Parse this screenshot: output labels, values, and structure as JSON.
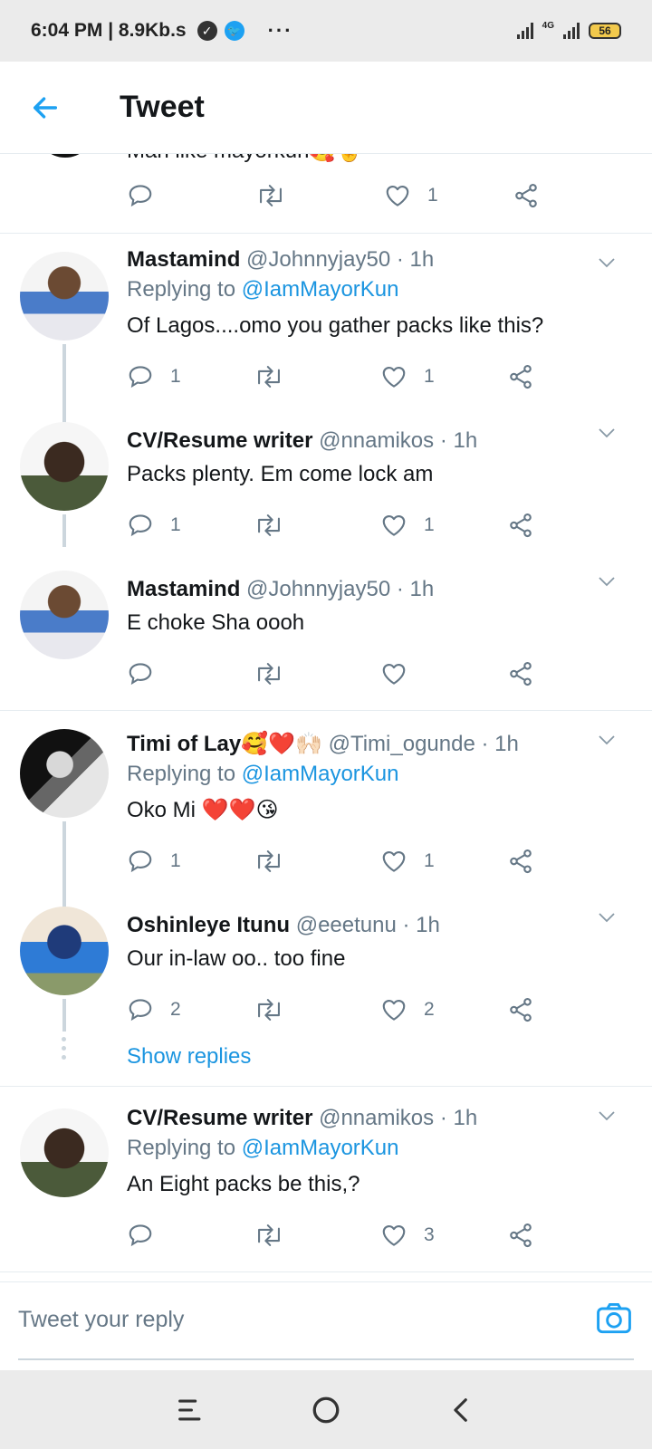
{
  "status_bar": {
    "time_and_speed": "6:04 PM | 8.9Kb.s",
    "more": "···",
    "network": "4G",
    "battery": "56"
  },
  "header": {
    "title": "Tweet"
  },
  "partial_tweet": {
    "text": "Man like mayorkun🥰✌️",
    "likes": "1"
  },
  "tweets": [
    {
      "name": "Mastamind",
      "handle_time": "@Johnnyjay50 · 1h",
      "replying_prefix": "Replying to ",
      "replying_to": "@IamMayorKun",
      "text": "Of Lagos....omo you gather packs like this?",
      "replies": "1",
      "likes": "1"
    },
    {
      "name": "CV/Resume writer",
      "handle_time": "@nnamikos · 1h",
      "text": "Packs plenty. Em come lock am",
      "replies": "1",
      "likes": "1"
    },
    {
      "name": "Mastamind",
      "handle_time": "@Johnnyjay50 · 1h",
      "text": "E choke Sha oooh",
      "replies": "",
      "likes": ""
    },
    {
      "name": "Timi of Lay🥰❤️🙌🏻",
      "handle_time": "@Timi_ogunde · 1h",
      "replying_prefix": "Replying to ",
      "replying_to": "@IamMayorKun",
      "text": "Oko Mi ❤️❤️😘",
      "replies": "1",
      "likes": "1"
    },
    {
      "name": "Oshinleye Itunu",
      "handle_time": "@eeetunu · 1h",
      "text": "Our in-law oo.. too fine",
      "replies": "2",
      "likes": "2",
      "show_replies": "Show replies"
    },
    {
      "name": "CV/Resume writer",
      "handle_time": "@nnamikos · 1h",
      "replying_prefix": "Replying to ",
      "replying_to": "@IamMayorKun",
      "text": "An Eight packs be this,?",
      "replies": "",
      "likes": "3"
    }
  ],
  "compose": {
    "placeholder": "Tweet your reply"
  },
  "colors": {
    "accent": "#1da1f2",
    "mention": "#1b95e0",
    "secondary_text": "#657786",
    "divider": "#e6ecf0"
  },
  "icons": [
    "back-arrow-icon",
    "reply-icon",
    "retweet-icon",
    "like-icon",
    "share-icon",
    "caret-down-icon",
    "camera-icon",
    "menu-icon",
    "home-circle-icon",
    "back-chevron-icon"
  ]
}
